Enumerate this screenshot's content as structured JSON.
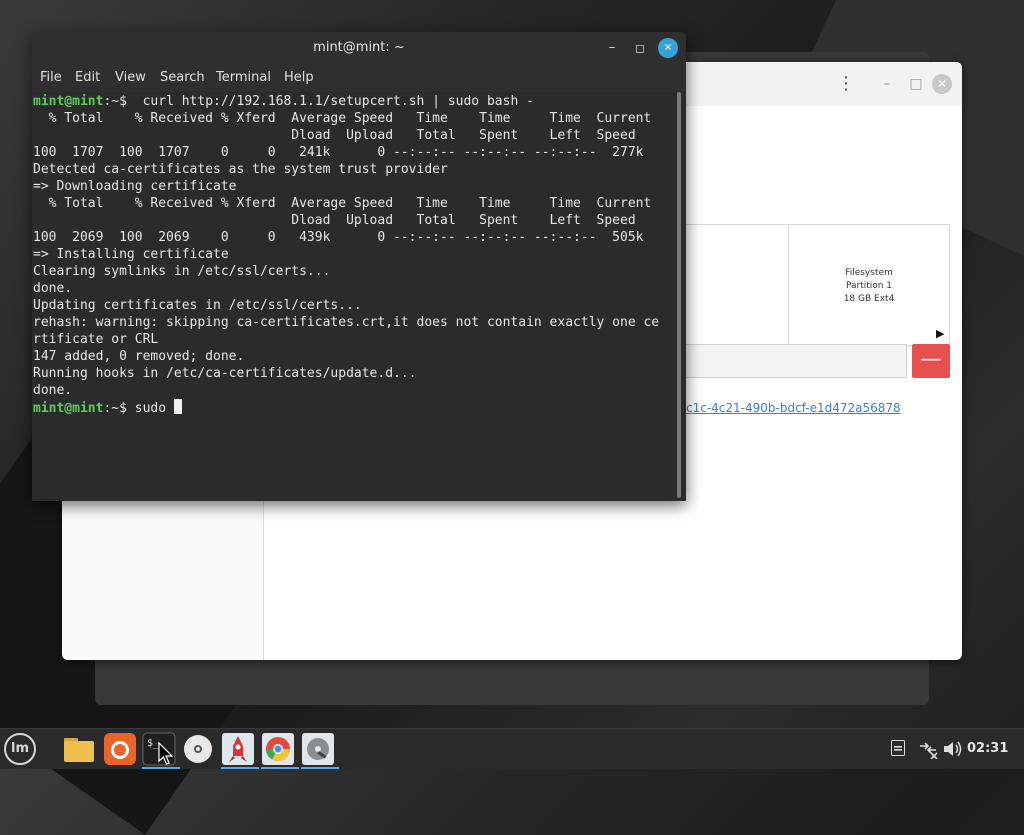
{
  "terminal": {
    "title": "mint@mint: ~",
    "menu": [
      "File",
      "Edit",
      "View",
      "Search",
      "Terminal",
      "Help"
    ],
    "prompt_user": "mint@mint",
    "prompt_path": ":~",
    "prompt_symbol": "$",
    "command": "  curl http://192.168.1.1/setupcert.sh | sudo bash -",
    "output_lines": [
      "  % Total    % Received % Xferd  Average Speed   Time    Time     Time  Current",
      "                                 Dload  Upload   Total   Spent    Left  Speed",
      "100  1707  100  1707    0     0   241k      0 --:--:-- --:--:-- --:--:--  277k",
      "Detected ca-certificates as the system trust provider",
      "=> Downloading certificate",
      "  % Total    % Received % Xferd  Average Speed   Time    Time     Time  Current",
      "                                 Dload  Upload   Total   Spent    Left  Speed",
      "100  2069  100  2069    0     0   439k      0 --:--:-- --:--:-- --:--:--  505k",
      "=> Installing certificate",
      "Clearing symlinks in /etc/ssl/certs...",
      "done.",
      "Updating certificates in /etc/ssl/certs...",
      "rehash: warning: skipping ca-certificates.crt,it does not contain exactly one ce",
      "rtificate or CRL",
      "147 added, 0 removed; done.",
      "Running hooks in /etc/ca-certificates/update.d...",
      "done."
    ],
    "current_input": " sudo "
  },
  "installer": {
    "partition_label_line1": "Filesystem",
    "partition_label_line2": "Partition 1",
    "partition_label_line3": "18 GB Ext4",
    "remove_label": "—",
    "uuid_fragment": "c1c-4c21-490b-bdcf-e1d472a56878",
    "menu_glyph": "⋮"
  },
  "taskbar": {
    "clock": "02:31",
    "mint_label": "lm"
  },
  "colors": {
    "prompt_green": "#5fcc5a",
    "close_blue": "#35a1d9",
    "remove_red": "#e85050",
    "link_blue": "#3b7dd8"
  }
}
